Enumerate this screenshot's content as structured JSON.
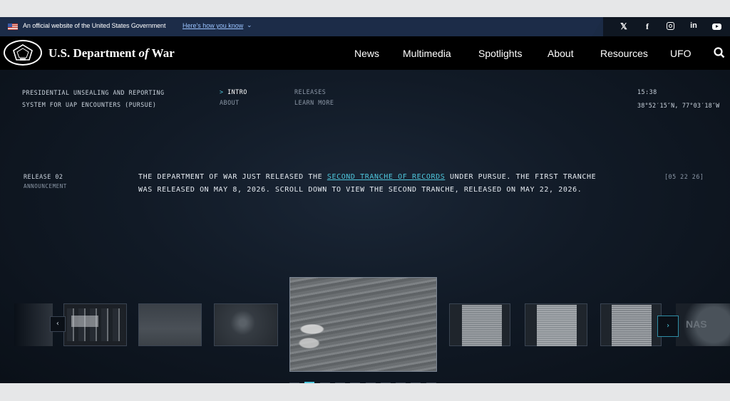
{
  "gov_banner": {
    "text": "An official website of the United States Government",
    "link": "Here's how you know",
    "social_icons": [
      "x-icon",
      "facebook-icon",
      "instagram-icon",
      "linkedin-icon",
      "youtube-icon"
    ]
  },
  "header": {
    "brand_prefix": "U.S. Department ",
    "brand_of": "of",
    "brand_suffix": " War",
    "nav": [
      "News",
      "Multimedia",
      "Spotlights",
      "About",
      "Resources",
      "UFO"
    ]
  },
  "pursue": {
    "title_line1": "PRESIDENTIAL UNSEALING AND REPORTING",
    "title_line2": "SYSTEM FOR UAP ENCOUNTERS (PURSUE)",
    "menu": {
      "intro_prompt": ">",
      "intro": "INTRO",
      "about": "ABOUT",
      "releases": "RELEASES",
      "learn_more": "LEARN MORE"
    },
    "time": "15:38",
    "coords": "38°52′15″N, 77°03′18″W"
  },
  "announcement": {
    "label": "RELEASE 02",
    "sublabel": "ANNOUNCEMENT",
    "line1_pre": "THE DEPARTMENT OF WAR JUST RELEASED THE ",
    "line1_link": "SECOND TRANCHE OF RECORDS",
    "line1_post": " UNDER PURSUE. THE FIRST TRANCHE",
    "line2": "WAS RELEASED ON MAY 8, 2026. SCROLL DOWN TO VIEW THE SECOND TRANCHE, RELEASED ON MAY 22, 2026.",
    "date": "[05 22 26]"
  },
  "carousel": {
    "prev": "‹",
    "next": "›",
    "watermark": "NAS",
    "dot_count": 10,
    "active_dot": 1
  }
}
